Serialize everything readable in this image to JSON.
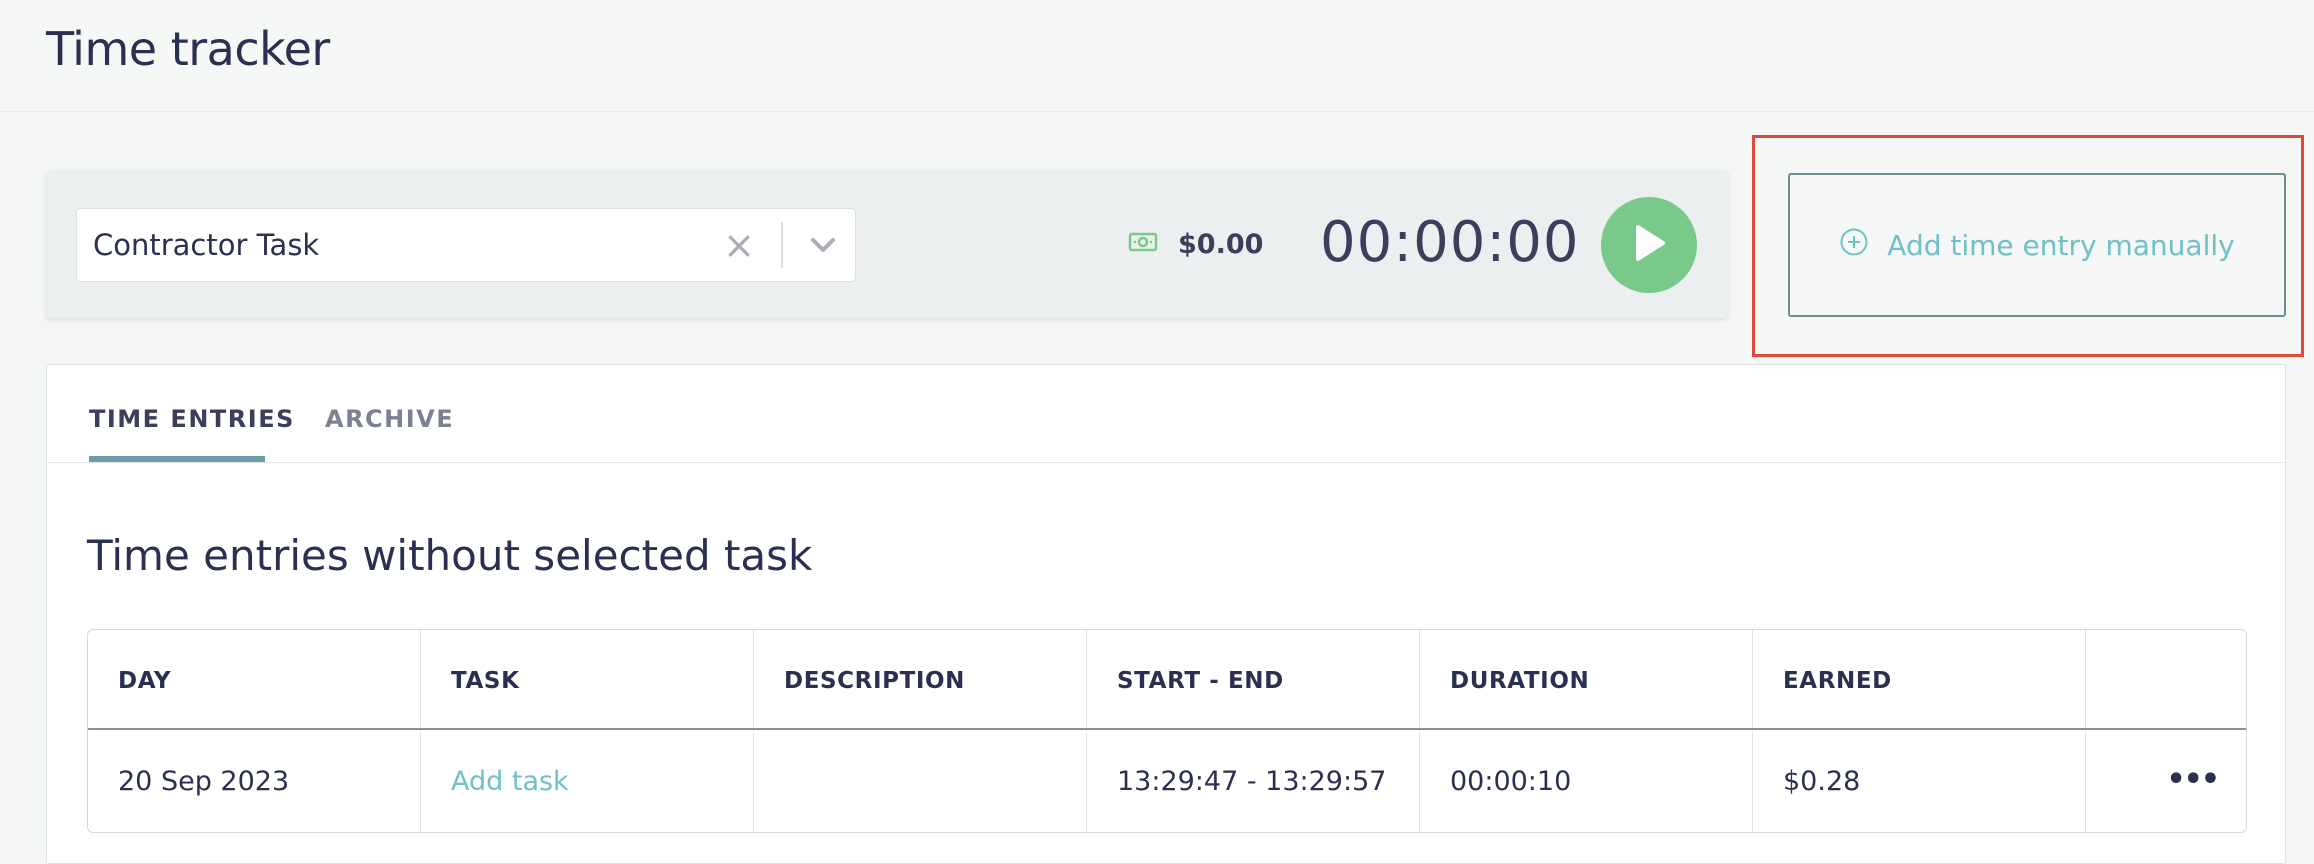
{
  "page": {
    "title": "Time tracker"
  },
  "tracker": {
    "task_value": "Contractor Task",
    "amount": "$0.00",
    "timer": "00:00:00"
  },
  "manual_entry": {
    "label": "Add time entry manually"
  },
  "tabs": [
    {
      "label": "TIME ENTRIES",
      "active": true
    },
    {
      "label": "ARCHIVE",
      "active": false
    }
  ],
  "section": {
    "title": "Time entries without selected task"
  },
  "table": {
    "headers": [
      "DAY",
      "TASK",
      "DESCRIPTION",
      "START - END",
      "DURATION",
      "EARNED",
      ""
    ],
    "rows": [
      {
        "day": "20 Sep 2023",
        "task": "Add task",
        "description": "",
        "start_end": "13:29:47 - 13:29:57",
        "duration": "00:00:10",
        "earned": "$0.28",
        "actions": "•••"
      }
    ]
  },
  "colors": {
    "accent": "#6fc1c5",
    "play": "#79c98a",
    "highlight": "#e0483a",
    "text": "#2c3050"
  },
  "icons": {
    "clear": "close-icon",
    "dropdown": "chevron-down-icon",
    "money": "banknote-icon",
    "play": "play-icon",
    "add": "plus-circle-icon",
    "more": "more-horizontal-icon"
  }
}
